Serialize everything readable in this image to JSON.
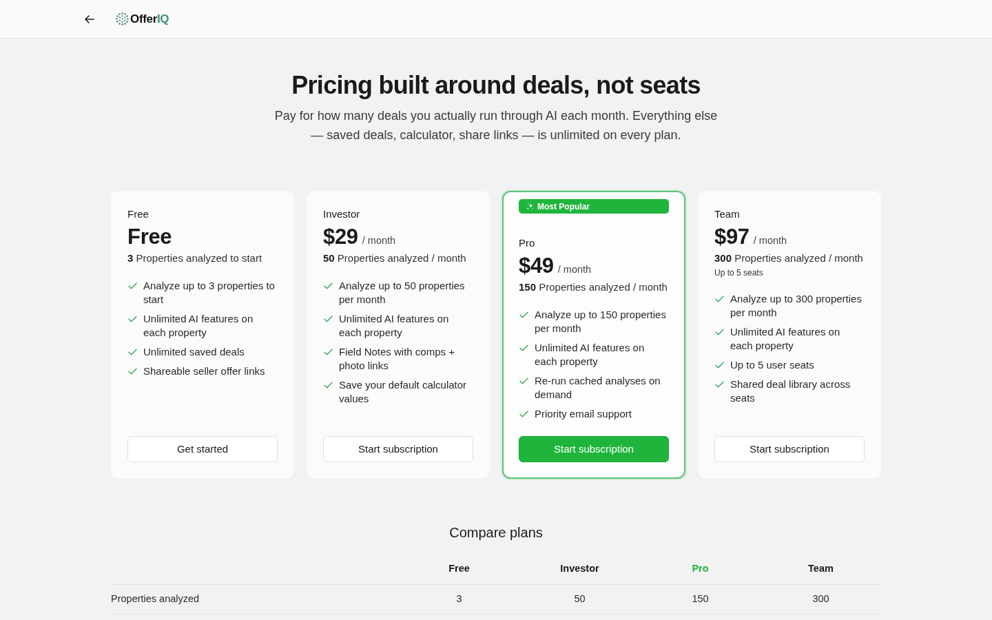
{
  "header": {
    "brand": {
      "text": "Offer",
      "accent": "IQ"
    }
  },
  "hero": {
    "title": "Pricing built around deals, not seats",
    "subtitle": "Pay for how many deals you actually run through AI each month. Everything else — saved deals, calculator, share links — is unlimited on every plan."
  },
  "plans": [
    {
      "name": "Free",
      "price": "Free",
      "quota": "**3** Properties analyzed to start",
      "features": [
        "Analyze up to 3 properties to start",
        "Unlimited AI features on each property",
        "Unlimited saved deals",
        "Shareable seller offer links"
      ],
      "cta": "Get started",
      "featured": false
    },
    {
      "name": "Investor",
      "price": "$29",
      "period": "/ month",
      "quota": "**50** Properties analyzed / month",
      "features": [
        "Analyze up to 50 properties per month",
        "Unlimited AI features on each property",
        "Field Notes with comps + photo links",
        "Save your default calculator values"
      ],
      "cta": "Start subscription",
      "featured": false
    },
    {
      "name": "Pro",
      "badge": "Most Popular",
      "price": "$49",
      "period": "/ month",
      "quota": "**150** Properties analyzed / month",
      "features": [
        "Analyze up to 150 properties per month",
        "Unlimited AI features on each property",
        "Re-run cached analyses on demand",
        "Priority email support"
      ],
      "cta": "Start subscription",
      "featured": true
    },
    {
      "name": "Team",
      "price": "$97",
      "period": "/ month",
      "quota": "**300** Properties analyzed / month",
      "note": "Up to 5 seats",
      "features": [
        "Analyze up to 300 properties per month",
        "Unlimited AI features on each property",
        "Up to 5 user seats",
        "Shared deal library across seats"
      ],
      "cta": "Start subscription",
      "featured": false
    }
  ],
  "compare": {
    "title": "Compare plans",
    "columns": [
      {
        "label": "Free",
        "featured": false
      },
      {
        "label": "Investor",
        "featured": false
      },
      {
        "label": "Pro",
        "featured": true
      },
      {
        "label": "Team",
        "featured": false
      }
    ],
    "rows": [
      {
        "label": "Properties analyzed",
        "values": [
          "3",
          "50",
          "150",
          "300"
        ]
      }
    ]
  }
}
